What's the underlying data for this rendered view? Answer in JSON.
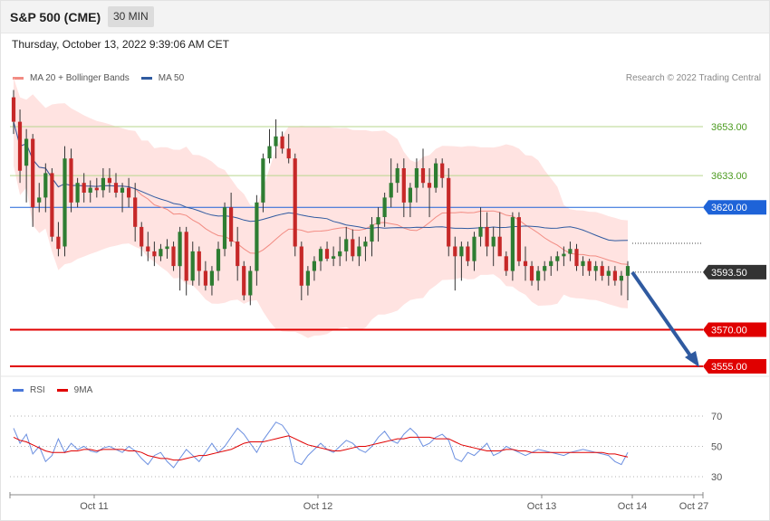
{
  "header": {
    "title": "S&P 500 (CME)",
    "interval": "30 MIN"
  },
  "timestamp": "Thursday, October 13, 2022 9:39:06 AM CET",
  "legend": [
    {
      "label": "MA 20 + Bollinger Bands",
      "color": "#f28b82"
    },
    {
      "label": "MA 50",
      "color": "#2f5aa0"
    }
  ],
  "credit": "Research © 2022 Trading Central",
  "rsi_legend": [
    {
      "label": "RSI",
      "color": "#4a78d9"
    },
    {
      "label": "9MA",
      "color": "#e00000"
    }
  ],
  "colors": {
    "up": "#2e7d32",
    "down": "#c62828",
    "band": "#ffe3e1",
    "resistance": "#b7d68e",
    "support": "#e00000",
    "pivot": "#1e63d8",
    "arrow": "#2f5aa0"
  },
  "chart_data": [
    {
      "type": "candlestick",
      "ylim": [
        3548,
        3683
      ],
      "x_ticks": [
        "Oct 11",
        "Oct 12",
        "Oct 13",
        "Oct 14",
        "Oct 27"
      ],
      "levels": [
        {
          "label": "3653.00",
          "value": 3653,
          "kind": "resistance"
        },
        {
          "label": "3633.00",
          "value": 3633,
          "kind": "resistance"
        },
        {
          "label": "3620.00",
          "value": 3620,
          "kind": "pivot"
        },
        {
          "label": "3593.50",
          "value": 3593.5,
          "kind": "last"
        },
        {
          "label": "3570.00",
          "value": 3570,
          "kind": "support"
        },
        {
          "label": "3555.00",
          "value": 3555,
          "kind": "support"
        }
      ],
      "candles": [
        [
          3665,
          3668,
          3650,
          3655
        ],
        [
          3655,
          3660,
          3630,
          3635
        ],
        [
          3637,
          3652,
          3622,
          3648
        ],
        [
          3648,
          3650,
          3612,
          3620
        ],
        [
          3622,
          3630,
          3618,
          3624
        ],
        [
          3624,
          3638,
          3618,
          3634
        ],
        [
          3634,
          3636,
          3606,
          3608
        ],
        [
          3608,
          3614,
          3600,
          3603
        ],
        [
          3604,
          3645,
          3600,
          3640
        ],
        [
          3640,
          3644,
          3618,
          3622
        ],
        [
          3622,
          3632,
          3620,
          3630
        ],
        [
          3630,
          3634,
          3622,
          3626
        ],
        [
          3626,
          3631,
          3622,
          3628
        ],
        [
          3628,
          3632,
          3624,
          3627
        ],
        [
          3627,
          3636,
          3624,
          3632
        ],
        [
          3632,
          3636,
          3626,
          3630
        ],
        [
          3630,
          3634,
          3624,
          3626
        ],
        [
          3626,
          3630,
          3618,
          3628
        ],
        [
          3628,
          3632,
          3620,
          3624
        ],
        [
          3624,
          3630,
          3606,
          3612
        ],
        [
          3612,
          3614,
          3600,
          3604
        ],
        [
          3604,
          3610,
          3598,
          3602
        ],
        [
          3602,
          3606,
          3596,
          3600
        ],
        [
          3600,
          3605,
          3598,
          3603
        ],
        [
          3603,
          3607,
          3599,
          3604
        ],
        [
          3604,
          3606,
          3594,
          3596
        ],
        [
          3596,
          3612,
          3586,
          3610
        ],
        [
          3610,
          3612,
          3584,
          3590
        ],
        [
          3590,
          3606,
          3588,
          3602
        ],
        [
          3602,
          3604,
          3588,
          3594
        ],
        [
          3594,
          3598,
          3586,
          3588
        ],
        [
          3588,
          3596,
          3584,
          3594
        ],
        [
          3594,
          3606,
          3590,
          3603
        ],
        [
          3603,
          3622,
          3600,
          3620
        ],
        [
          3620,
          3626,
          3604,
          3606
        ],
        [
          3606,
          3612,
          3590,
          3596
        ],
        [
          3596,
          3598,
          3582,
          3584
        ],
        [
          3584,
          3596,
          3580,
          3594
        ],
        [
          3594,
          3625,
          3588,
          3622
        ],
        [
          3622,
          3642,
          3618,
          3640
        ],
        [
          3640,
          3652,
          3638,
          3645
        ],
        [
          3645,
          3656,
          3640,
          3649
        ],
        [
          3649,
          3651,
          3642,
          3644
        ],
        [
          3644,
          3650,
          3638,
          3640
        ],
        [
          3640,
          3642,
          3600,
          3604
        ],
        [
          3604,
          3606,
          3582,
          3588
        ],
        [
          3588,
          3596,
          3584,
          3594
        ],
        [
          3594,
          3600,
          3590,
          3598
        ],
        [
          3598,
          3604,
          3594,
          3603
        ],
        [
          3603,
          3606,
          3598,
          3599
        ],
        [
          3599,
          3604,
          3596,
          3600
        ],
        [
          3600,
          3608,
          3596,
          3602
        ],
        [
          3602,
          3612,
          3598,
          3607
        ],
        [
          3607,
          3611,
          3598,
          3600
        ],
        [
          3600,
          3608,
          3596,
          3604
        ],
        [
          3604,
          3608,
          3598,
          3606
        ],
        [
          3606,
          3616,
          3600,
          3613
        ],
        [
          3613,
          3620,
          3606,
          3616
        ],
        [
          3616,
          3626,
          3612,
          3624
        ],
        [
          3624,
          3640,
          3620,
          3630
        ],
        [
          3630,
          3638,
          3626,
          3636
        ],
        [
          3636,
          3640,
          3616,
          3622
        ],
        [
          3622,
          3630,
          3616,
          3628
        ],
        [
          3628,
          3640,
          3622,
          3636
        ],
        [
          3636,
          3644,
          3628,
          3630
        ],
        [
          3630,
          3636,
          3616,
          3628
        ],
        [
          3628,
          3640,
          3626,
          3638
        ],
        [
          3638,
          3640,
          3628,
          3632
        ],
        [
          3632,
          3636,
          3600,
          3604
        ],
        [
          3604,
          3608,
          3586,
          3600
        ],
        [
          3600,
          3606,
          3590,
          3604
        ],
        [
          3604,
          3606,
          3596,
          3598
        ],
        [
          3598,
          3610,
          3594,
          3608
        ],
        [
          3608,
          3620,
          3604,
          3612
        ],
        [
          3612,
          3618,
          3600,
          3604
        ],
        [
          3604,
          3612,
          3596,
          3608
        ],
        [
          3608,
          3618,
          3604,
          3600
        ],
        [
          3600,
          3602,
          3592,
          3594
        ],
        [
          3594,
          3618,
          3590,
          3616
        ],
        [
          3616,
          3618,
          3596,
          3598
        ],
        [
          3598,
          3604,
          3590,
          3596
        ],
        [
          3596,
          3598,
          3588,
          3590
        ],
        [
          3590,
          3596,
          3586,
          3594
        ],
        [
          3594,
          3598,
          3590,
          3596
        ],
        [
          3596,
          3600,
          3592,
          3598
        ],
        [
          3598,
          3602,
          3594,
          3600
        ],
        [
          3600,
          3604,
          3596,
          3601
        ],
        [
          3601,
          3606,
          3598,
          3603
        ],
        [
          3603,
          3605,
          3594,
          3596
        ],
        [
          3596,
          3600,
          3592,
          3598
        ],
        [
          3598,
          3599,
          3592,
          3594
        ],
        [
          3594,
          3598,
          3590,
          3596
        ],
        [
          3596,
          3598,
          3590,
          3592
        ],
        [
          3592,
          3596,
          3588,
          3594
        ],
        [
          3594,
          3596,
          3588,
          3590
        ],
        [
          3590,
          3594,
          3584,
          3592
        ],
        [
          3592,
          3598,
          3582,
          3596
        ]
      ]
    },
    {
      "type": "line",
      "title": "RSI",
      "ylim": [
        22,
        78
      ],
      "y_ticks": [
        70,
        50,
        30
      ],
      "series": [
        {
          "name": "RSI",
          "values": [
            62,
            52,
            58,
            45,
            50,
            40,
            44,
            55,
            46,
            52,
            48,
            50,
            47,
            46,
            49,
            50,
            48,
            46,
            50,
            47,
            42,
            38,
            44,
            46,
            40,
            36,
            42,
            48,
            44,
            40,
            46,
            52,
            46,
            50,
            56,
            62,
            58,
            52,
            46,
            54,
            60,
            66,
            64,
            58,
            40,
            38,
            44,
            48,
            52,
            48,
            46,
            50,
            54,
            52,
            48,
            46,
            50,
            56,
            60,
            54,
            52,
            58,
            62,
            58,
            50,
            52,
            56,
            58,
            54,
            42,
            40,
            46,
            44,
            48,
            52,
            44,
            46,
            50,
            48,
            46,
            44,
            46,
            48,
            47,
            46,
            45,
            44,
            46,
            47,
            48,
            47,
            46,
            45,
            44,
            40,
            38,
            46
          ]
        },
        {
          "name": "9MA",
          "values": [
            56,
            54,
            53,
            51,
            49,
            47,
            46,
            46,
            46,
            47,
            47,
            48,
            48,
            47,
            48,
            48,
            48,
            48,
            47,
            47,
            46,
            44,
            43,
            42,
            42,
            41,
            41,
            42,
            43,
            44,
            44,
            45,
            46,
            47,
            48,
            50,
            52,
            53,
            53,
            53,
            54,
            55,
            56,
            57,
            55,
            53,
            51,
            50,
            49,
            48,
            47,
            47,
            48,
            49,
            50,
            50,
            51,
            52,
            53,
            54,
            55,
            55,
            56,
            56,
            56,
            56,
            55,
            55,
            55,
            53,
            51,
            50,
            49,
            48,
            47,
            47,
            47,
            48,
            48,
            47,
            47,
            46,
            46,
            46,
            46,
            46,
            46,
            46,
            46,
            46,
            46,
            46,
            46,
            45,
            45,
            44,
            43
          ]
        }
      ]
    }
  ]
}
